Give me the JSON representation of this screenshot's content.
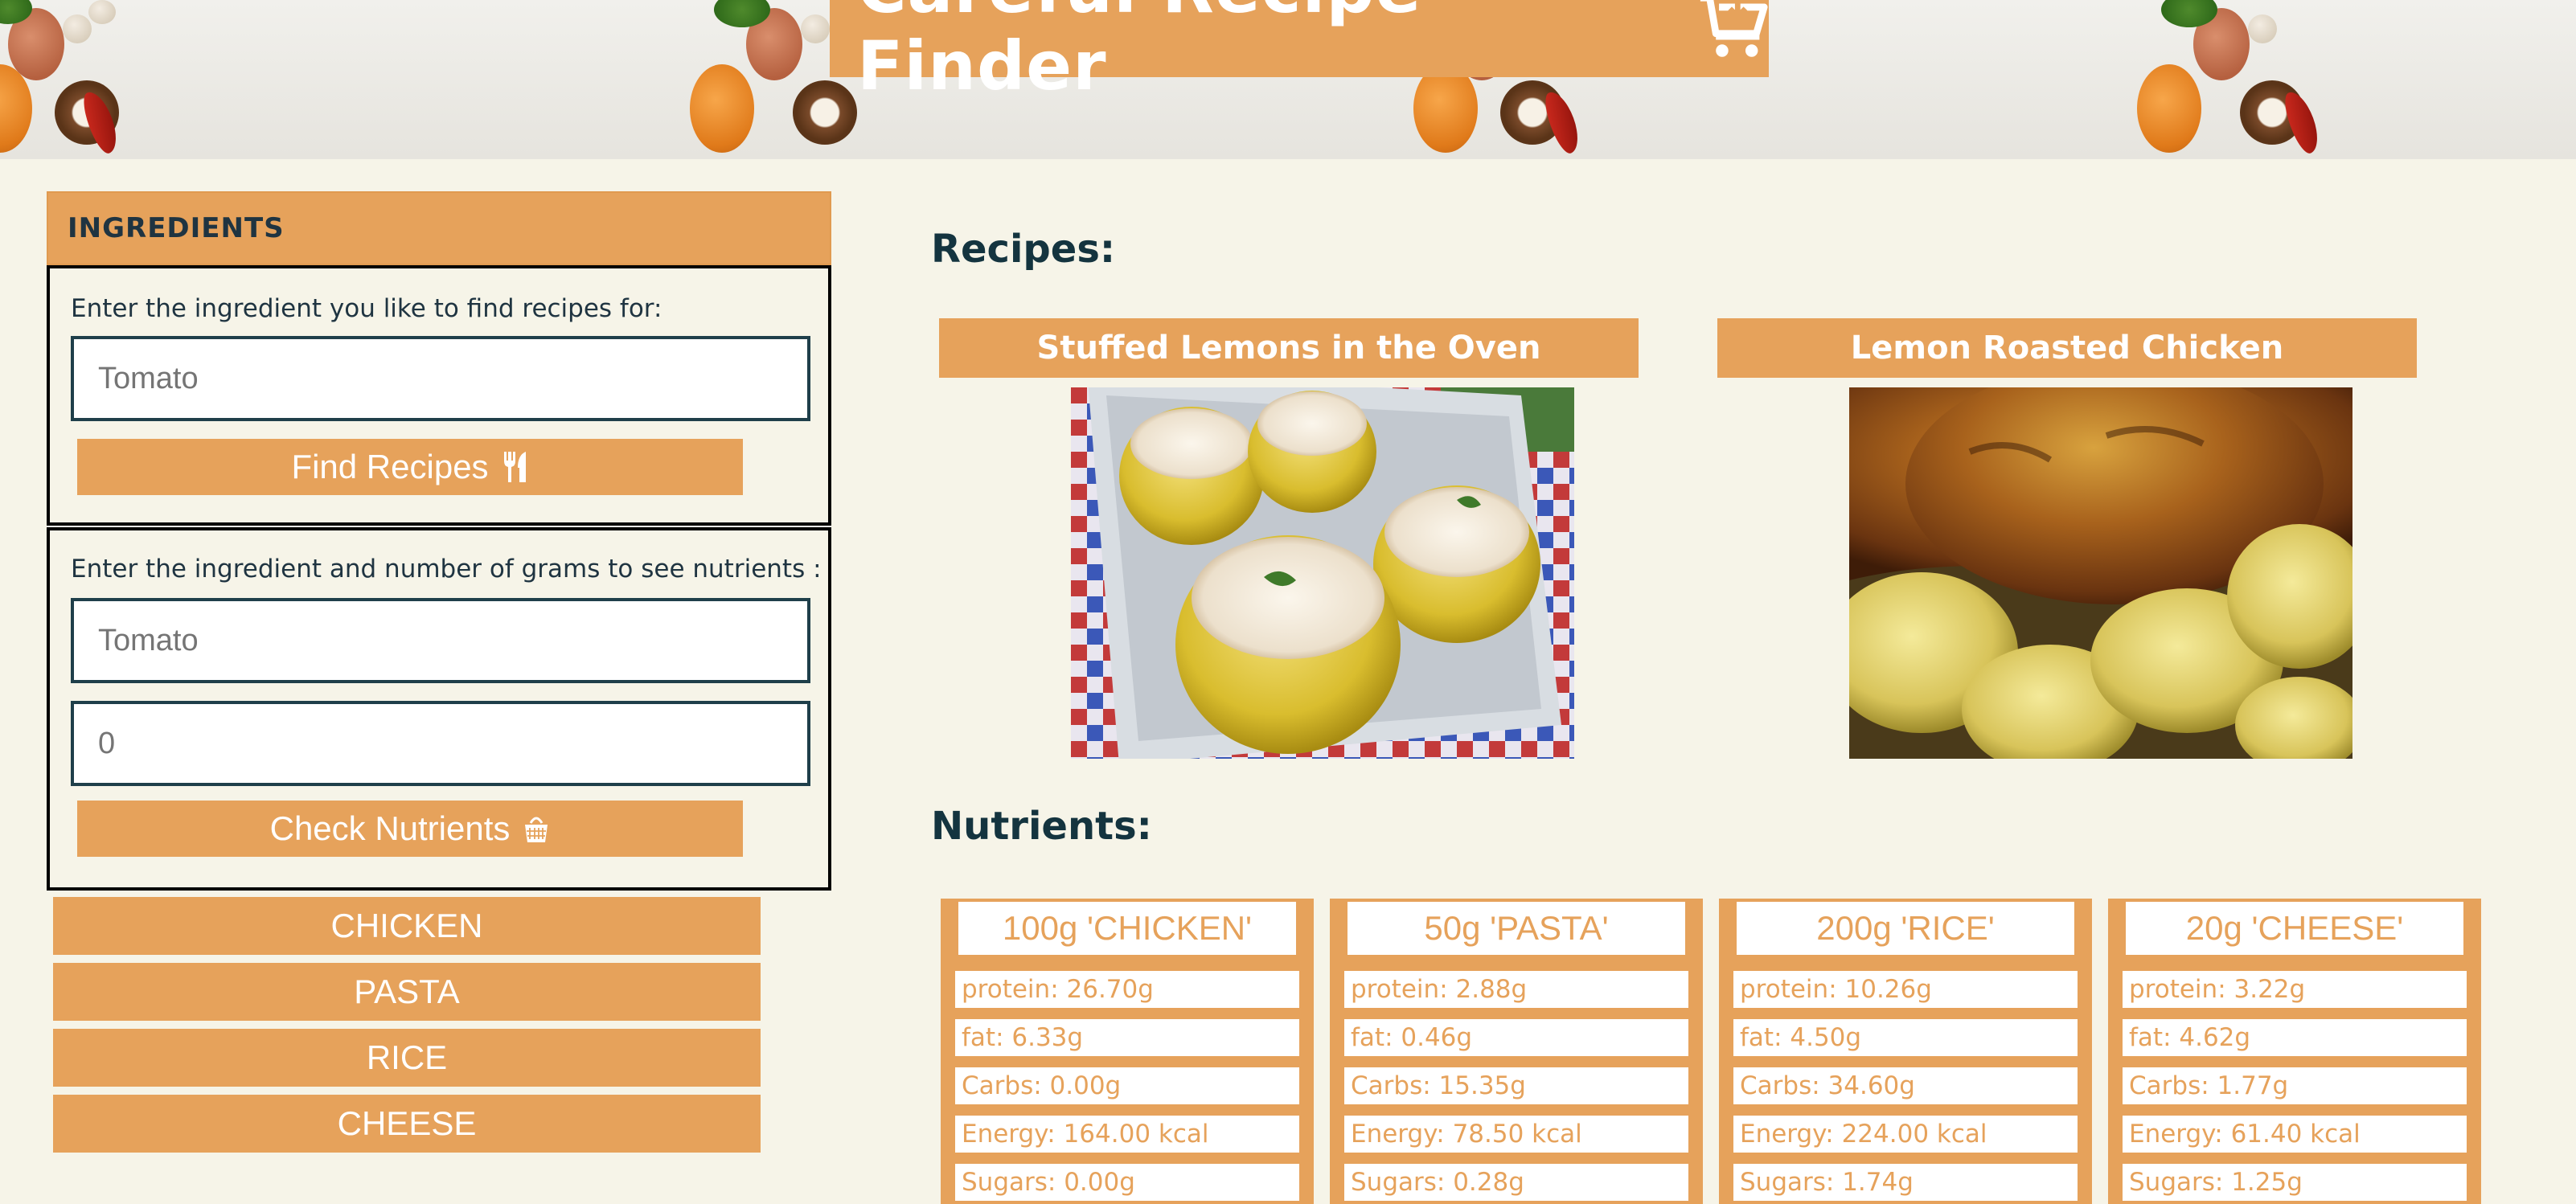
{
  "header": {
    "title": "Careful Recipe Finder",
    "cart_icon": "shopping-cart-download-icon"
  },
  "ingredients_panel": {
    "heading": "INGREDIENTS",
    "recipe_search": {
      "label": "Enter the ingredient you like to find recipes for:",
      "placeholder": "Tomato",
      "value": "",
      "button_label": "Find Recipes",
      "button_icon": "fork-knife-icon"
    },
    "nutrient_search": {
      "label": "Enter the ingredient and number of grams to see nutrients :",
      "ingredient_placeholder": "Tomato",
      "grams_placeholder": "0",
      "button_label": "Check Nutrients",
      "button_icon": "basket-icon"
    },
    "history": [
      "CHICKEN",
      "PASTA",
      "RICE",
      "CHEESE"
    ]
  },
  "recipes": {
    "heading": "Recipes:",
    "items": [
      {
        "title": "Stuffed Lemons in the Oven"
      },
      {
        "title": "Lemon Roasted Chicken"
      }
    ]
  },
  "nutrients": {
    "heading": "Nutrients:",
    "cards": [
      {
        "title": "100g 'CHICKEN'",
        "rows": [
          "protein: 26.70g",
          "fat: 6.33g",
          "Carbs: 0.00g",
          "Energy: 164.00 kcal",
          "Sugars: 0.00g"
        ]
      },
      {
        "title": "50g 'PASTA'",
        "rows": [
          "protein: 2.88g",
          "fat: 0.46g",
          "Carbs: 15.35g",
          "Energy: 78.50 kcal",
          "Sugars: 0.28g"
        ]
      },
      {
        "title": "200g 'RICE'",
        "rows": [
          "protein: 10.26g",
          "fat: 4.50g",
          "Carbs: 34.60g",
          "Energy: 224.00 kcal",
          "Sugars: 1.74g"
        ]
      },
      {
        "title": "20g 'CHEESE'",
        "rows": [
          "protein: 3.22g",
          "fat: 4.62g",
          "Carbs: 1.77g",
          "Energy: 61.40 kcal",
          "Sugars: 1.25g"
        ]
      }
    ]
  },
  "colors": {
    "accent": "#e6a25b",
    "background": "#f6f4e8",
    "text_dark": "#1f3441"
  }
}
